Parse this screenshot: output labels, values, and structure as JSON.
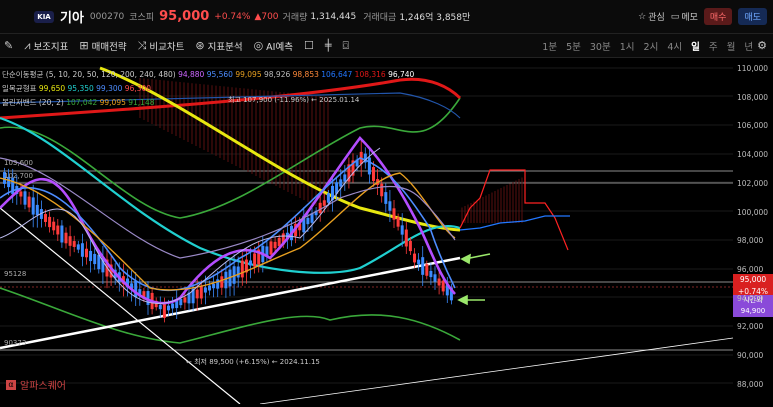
{
  "header": {
    "name": "기아",
    "code": "000270",
    "market": "코스피",
    "price": "95,000",
    "change_pct": "+0.74%",
    "change_abs": "▲700",
    "volume_label": "거래량",
    "volume": "1,314,445",
    "amount_label": "거래대금",
    "amount": "1,246억 3,858만",
    "favorite": "관심",
    "memo": "메모",
    "buy": "매수",
    "sell": "매도"
  },
  "toolbar": {
    "indicators": "보조지표",
    "strategy": "매매전략",
    "compare": "비교차트",
    "analysis": "지표분석",
    "ai": "AI예측",
    "timeframes": [
      "1분",
      "5분",
      "30분",
      "1시",
      "2시",
      "4시",
      "일",
      "주",
      "월",
      "년"
    ],
    "active_timeframe": "일"
  },
  "legend": {
    "sma_name": "단순이동평균 (5, 10, 20, 50, 120, 200, 240, 480)",
    "sma_values": [
      "94,880",
      "95,560",
      "99,095",
      "98,926",
      "98,853",
      "106,647",
      "108,316",
      "96,740"
    ],
    "ichimoku_name": "일목균형표",
    "ichimoku_values": [
      "99,650",
      "95,350",
      "99,300",
      "96,300"
    ],
    "bollinger_name": "볼린저밴드 (20, 2)",
    "bollinger_values": [
      "107,042",
      "99,095",
      "91,148"
    ]
  },
  "annotations": {
    "high": "최고 107,900 (-11.96%) ← 2025.01.14",
    "low": "← 최저 89,500 (+6.15%) ← 2024.11.15",
    "level_103": "103,600",
    "level_102": "102,700",
    "level_95": "95128",
    "level_90": "90373"
  },
  "axis": {
    "labels": [
      "110,000",
      "108,000",
      "106,000",
      "104,000",
      "102,000",
      "100,000",
      "98,000",
      "96,000",
      "94,000",
      "92,000",
      "90,000",
      "88,000"
    ],
    "tag_price": "95,000",
    "tag_change": "+0.74%",
    "tag_time_label": "시간외",
    "tag_time_price": "94,900"
  },
  "watermark": "알파스퀘어",
  "colors": {
    "up": "#ff4d4d",
    "down": "#4d8dff",
    "accent": "#b44dff"
  }
}
